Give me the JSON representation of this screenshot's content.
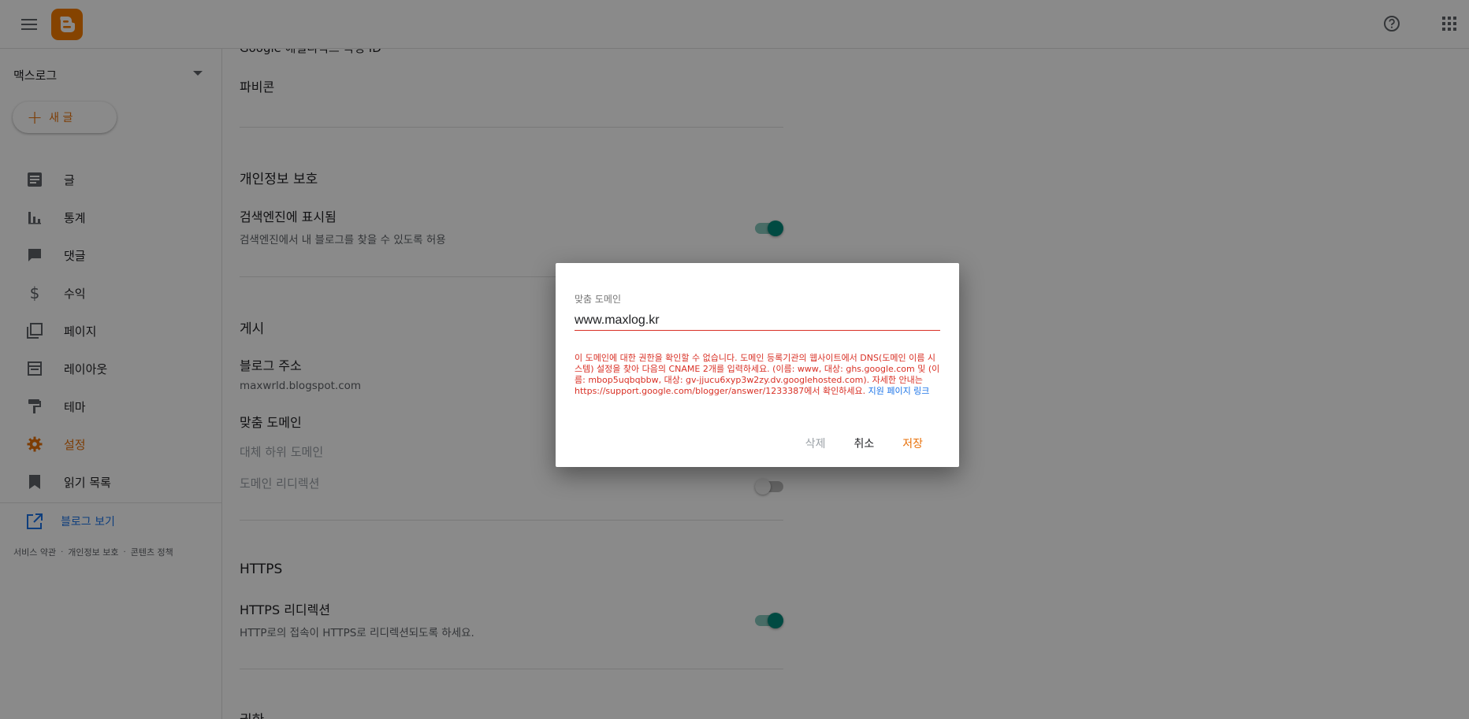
{
  "colors": {
    "accent": "#e8710a",
    "logo": "#f57d00",
    "toggle_on": "#00897b",
    "error": "#d93025",
    "link": "#1a73e8"
  },
  "topbar": {
    "menu_icon": "hamburger-menu-icon",
    "logo_icon": "blogger-logo-icon",
    "help_icon": "help-circle-icon",
    "apps_icon": "apps-grid-icon"
  },
  "sidebar": {
    "blog_name": "맥스로그",
    "new_post_label": "새 글",
    "items": [
      {
        "label": "글",
        "icon": "posts-icon"
      },
      {
        "label": "통계",
        "icon": "stats-icon"
      },
      {
        "label": "댓글",
        "icon": "comments-icon"
      },
      {
        "label": "수익",
        "icon": "dollar-icon"
      },
      {
        "label": "페이지",
        "icon": "pages-icon"
      },
      {
        "label": "레이아웃",
        "icon": "layout-icon"
      },
      {
        "label": "테마",
        "icon": "theme-paint-roller-icon"
      },
      {
        "label": "설정",
        "icon": "settings-gear-icon"
      },
      {
        "label": "읽기 목록",
        "icon": "bookmark-icon"
      }
    ],
    "view_blog_label": "블로그 보기",
    "footer": [
      "서비스 약관",
      "개인정보 보호",
      "콘텐츠 정책"
    ]
  },
  "main": {
    "cut_title": "Google 애널리틱스 측정 ID",
    "favicon_label": "파비콘",
    "privacy": {
      "section": "개인정보 보호",
      "search_label": "검색엔진에 표시됨",
      "search_sub": "검색엔진에서 내 블로그를 찾을 수 있도록 허용",
      "search_on": true
    },
    "publishing": {
      "section": "게시",
      "address_label": "블로그 주소",
      "address_value": "maxwrld.blogspot.com",
      "custom_domain_label": "맞춤 도메인",
      "fallback_label": "대체 하위 도메인",
      "redirect_label": "도메인 리디렉션",
      "redirect_on": false
    },
    "https": {
      "section": "HTTPS",
      "redirect_label": "HTTPS 리디렉션",
      "redirect_sub": "HTTP로의 접속이 HTTPS로 리디렉션되도록 하세요.",
      "redirect_on": true
    },
    "cut_bottom": "권한"
  },
  "dialog": {
    "label": "맞춤 도메인",
    "input_value": "www.maxlog.kr",
    "error_text": "이 도메인에 대한 권한을 확인할 수 없습니다. 도메인 등록기관의 웹사이트에서 DNS(도메인 이름 시스템) 설정을 찾아 다음의 CNAME 2개를 입력하세요. (이름: www, 대상: ghs.google.com 및 (이름: mbop5uqbqbbw, 대상: gv-jjucu6xyp3w2zy.dv.googlehosted.com). 자세한 안내는 https://support.google.com/blogger/answer/1233387에서 확인하세요.",
    "link_text": "지원 페이지 링크",
    "delete_label": "삭제",
    "cancel_label": "취소",
    "save_label": "저장"
  }
}
